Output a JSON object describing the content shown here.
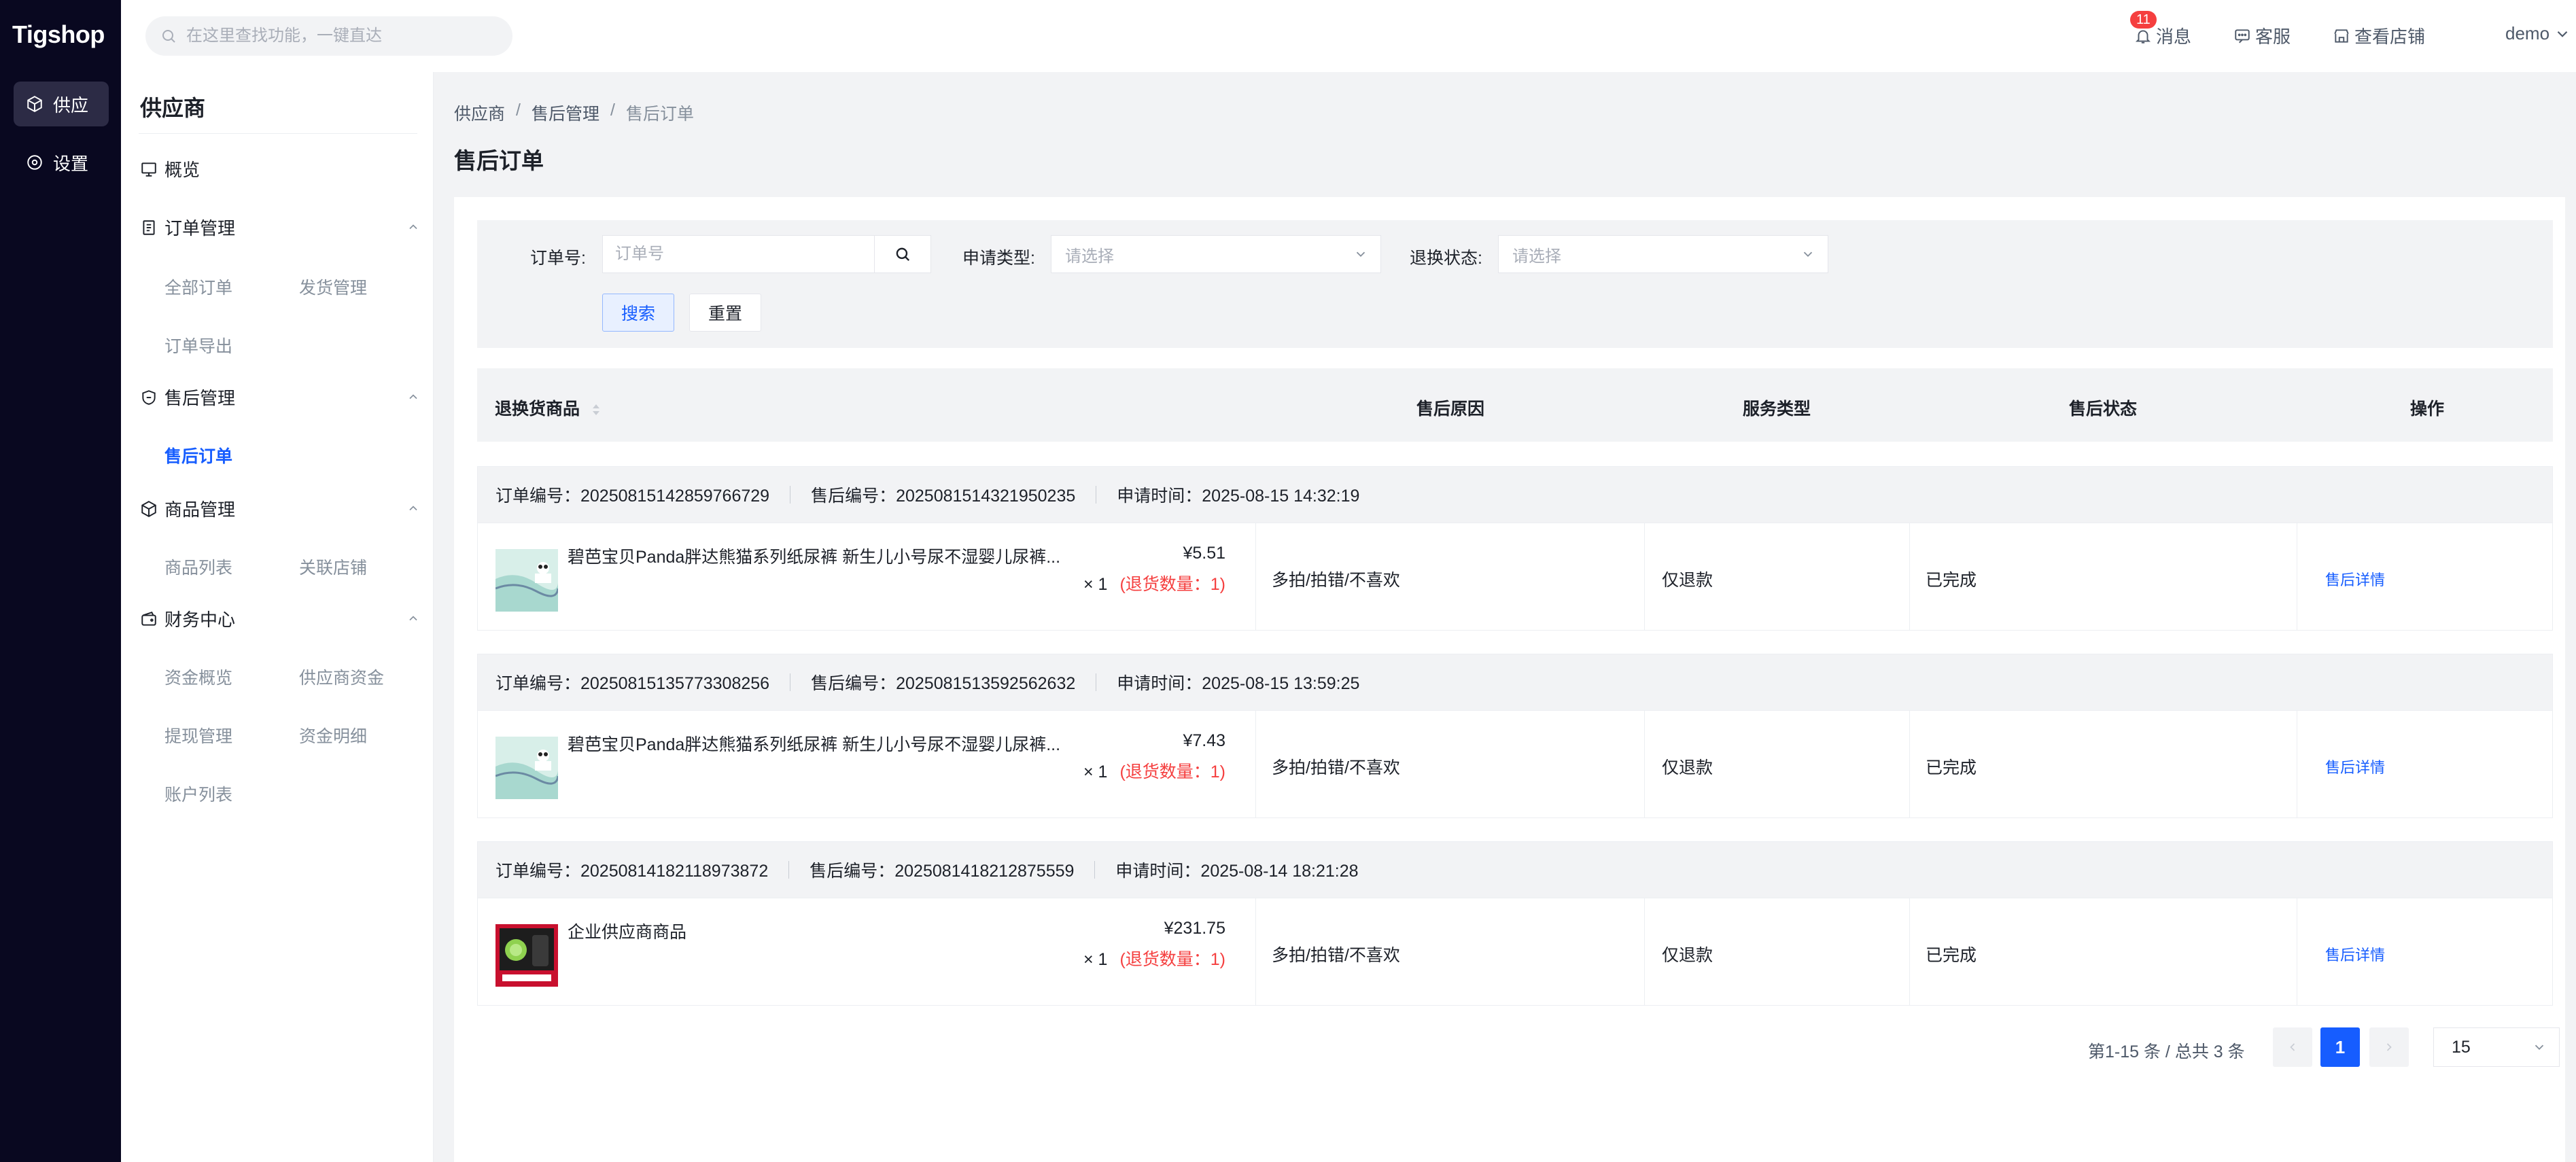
{
  "app": {
    "logo": "Tigshop"
  },
  "rail": {
    "items": [
      {
        "label": "供应",
        "icon": "cube-icon"
      },
      {
        "label": "设置",
        "icon": "gear-icon"
      }
    ]
  },
  "header": {
    "search_placeholder": "在这里查找功能，一键直达",
    "notice_count": "11",
    "notice_label": "消息",
    "service_label": "客服",
    "shop_label": "查看店铺",
    "user_name": "demo"
  },
  "sidebar": {
    "title": "供应商",
    "overview": "概览",
    "groups": [
      {
        "label": "订单管理",
        "items": [
          "全部订单",
          "发货管理",
          "订单导出"
        ]
      },
      {
        "label": "售后管理",
        "items": [
          "售后订单"
        ]
      },
      {
        "label": "商品管理",
        "items": [
          "商品列表",
          "关联店铺"
        ]
      },
      {
        "label": "财务中心",
        "items": [
          "资金概览",
          "供应商资金",
          "提现管理",
          "资金明细",
          "账户列表"
        ]
      }
    ]
  },
  "breadcrumb": [
    "供应商",
    "/",
    "售后管理",
    "/",
    "售后订单"
  ],
  "page_title": "售后订单",
  "filter": {
    "order_label": "订单号:",
    "order_placeholder": "订单号",
    "type_label": "申请类型:",
    "type_placeholder": "请选择",
    "status_label": "退换状态:",
    "status_placeholder": "请选择",
    "search_btn": "搜索",
    "reset_btn": "重置"
  },
  "table": {
    "columns": [
      "退换货商品",
      "售后原因",
      "服务类型",
      "售后状态",
      "操作"
    ],
    "rows": [
      {
        "order_no": "订单编号：20250815142859766729",
        "aftersale_no": "售后编号：2025081514321950235",
        "apply_time": "申请时间：2025-08-15 14:32:19",
        "product": "碧芭宝贝Panda胖达熊猫系列纸尿裤 新生儿小号尿不湿婴儿尿裤...",
        "price": "¥5.51",
        "qty": "× 1",
        "return_qty": "(退货数量：1)",
        "reason": "多拍/拍错/不喜欢",
        "service": "仅退款",
        "status": "已完成",
        "action": "售后详情"
      },
      {
        "order_no": "订单编号：20250815135773308256",
        "aftersale_no": "售后编号：2025081513592562632",
        "apply_time": "申请时间：2025-08-15 13:59:25",
        "product": "碧芭宝贝Panda胖达熊猫系列纸尿裤 新生儿小号尿不湿婴儿尿裤...",
        "price": "¥7.43",
        "qty": "× 1",
        "return_qty": "(退货数量：1)",
        "reason": "多拍/拍错/不喜欢",
        "service": "仅退款",
        "status": "已完成",
        "action": "售后详情"
      },
      {
        "order_no": "订单编号：20250814182118973872",
        "aftersale_no": "售后编号：2025081418212875559",
        "apply_time": "申请时间：2025-08-14 18:21:28",
        "product": "企业供应商商品",
        "price": "¥231.75",
        "qty": "× 1",
        "return_qty": "(退货数量：1)",
        "reason": "多拍/拍错/不喜欢",
        "service": "仅退款",
        "status": "已完成",
        "action": "售后详情"
      }
    ]
  },
  "pagination": {
    "summary": "第1-15 条 / 总共 3 条",
    "current": "1",
    "page_size": "15"
  },
  "colors": {
    "accent": "#165dff",
    "rail": "#090820",
    "danger": "#f53f3f"
  }
}
